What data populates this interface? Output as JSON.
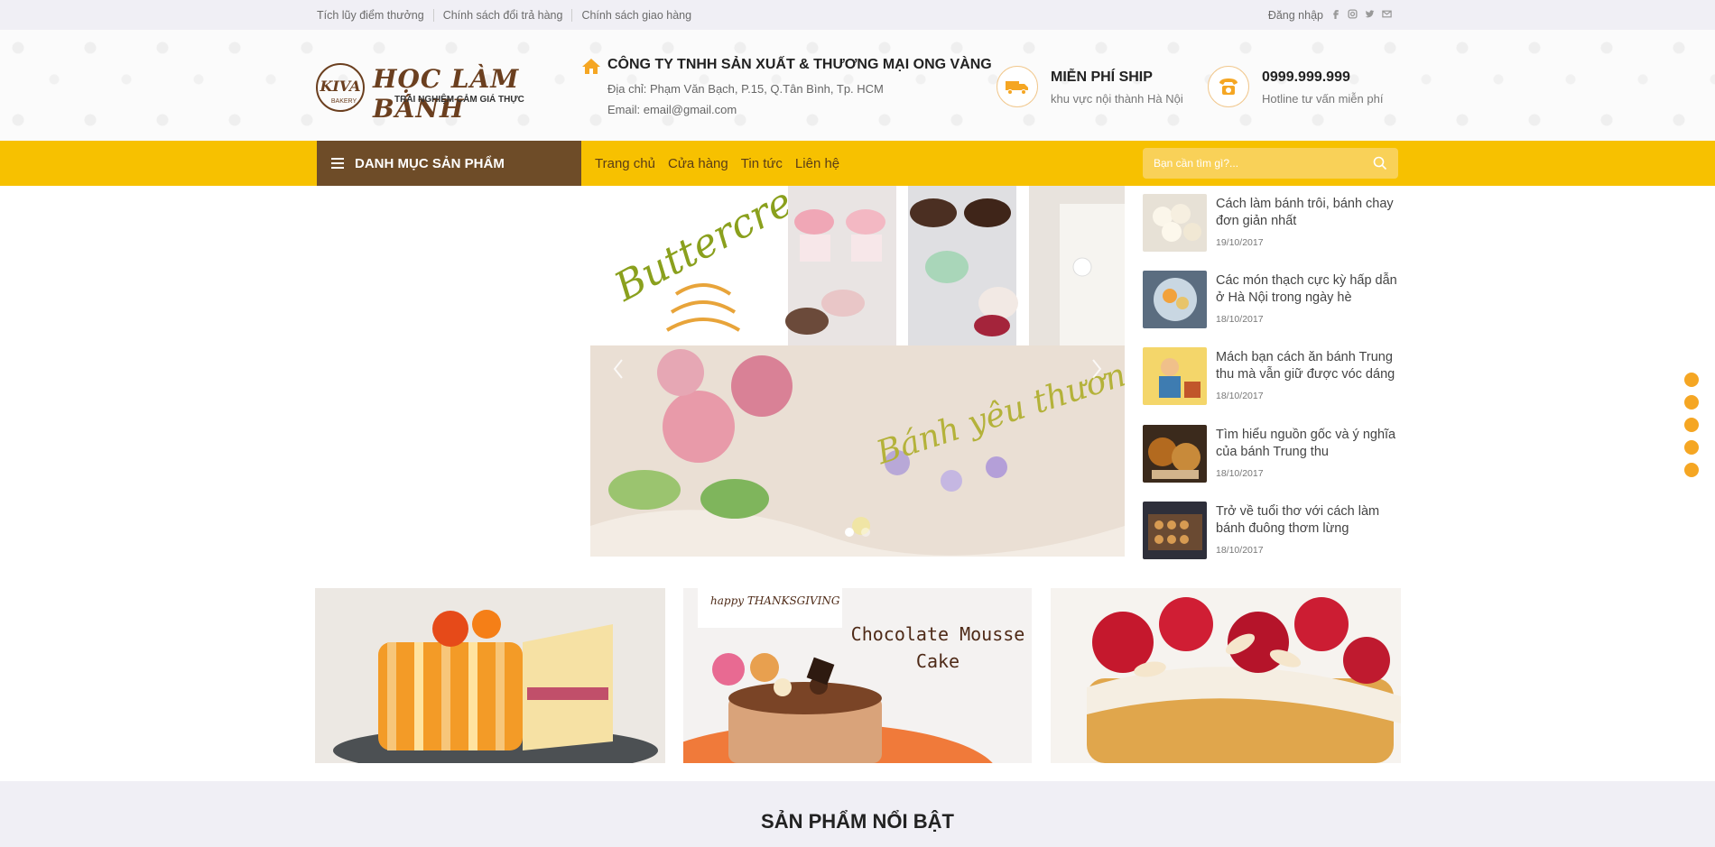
{
  "topbar": {
    "links": [
      "Tích lũy điểm thưởng",
      "Chính sách đổi trả hàng",
      "Chính sách giao hàng"
    ],
    "login": "Đăng nhập",
    "social_icons": [
      "facebook-icon",
      "instagram-icon",
      "twitter-icon",
      "mail-icon"
    ]
  },
  "header": {
    "logo": {
      "brand": "HỌC LÀM BÁNH",
      "slogan": "TRẢI NGHIỆM CẢM GIÁ THỰC",
      "mark": "KIVA",
      "mark_sub": "BAKERY"
    },
    "company": {
      "name": "CÔNG TY TNHH SẢN XUẤT & THƯƠNG MẠI ONG VÀNG",
      "address": "Địa chỉ: Phạm Văn Bạch, P.15, Q.Tân Bình, Tp. HCM",
      "email": "Email: email@gmail.com"
    },
    "shipping": {
      "title": "MIỄN PHÍ SHIP",
      "subtitle": "khu vực nội thành Hà Nội"
    },
    "hotline": {
      "number": "0999.999.999",
      "subtitle": "Hotline tư vấn miễn phí"
    }
  },
  "nav": {
    "category_label": "DANH MỤC SẢN PHẨM",
    "menu": [
      "Trang chủ",
      "Cửa hàng",
      "Tin tức",
      "Liên hệ"
    ],
    "search_placeholder": "Bạn cần tìm gì?..."
  },
  "banner": {
    "top_text": "Buttercream",
    "slider_text": "Bánh yêu thương",
    "slider_active_index": 0,
    "slider_total": 2
  },
  "news": [
    {
      "title": "Cách làm bánh trôi, bánh chay đơn giản nhất",
      "date": "19/10/2017"
    },
    {
      "title": "Các món thạch cực kỳ hấp dẫn ở Hà Nội trong ngày hè",
      "date": "18/10/2017"
    },
    {
      "title": "Mách bạn cách ăn bánh Trung thu mà vẫn giữ được vóc dáng",
      "date": "18/10/2017"
    },
    {
      "title": "Tìm hiểu nguồn gốc và ý nghĩa của bánh Trung thu",
      "date": "18/10/2017"
    },
    {
      "title": "Trở về tuổi thơ với cách làm bánh đuông thơm lừng",
      "date": "18/10/2017"
    }
  ],
  "promo": [
    {
      "caption": ""
    },
    {
      "caption": "Chocolate Mousse Cake",
      "tag": "happy THANKSGIVING"
    },
    {
      "caption": ""
    }
  ],
  "section": {
    "title": "SẢN PHẨM NỔI BẬT"
  },
  "colors": {
    "nav": "#f7c100",
    "category": "#6e4c28",
    "accent": "#f5a623"
  }
}
